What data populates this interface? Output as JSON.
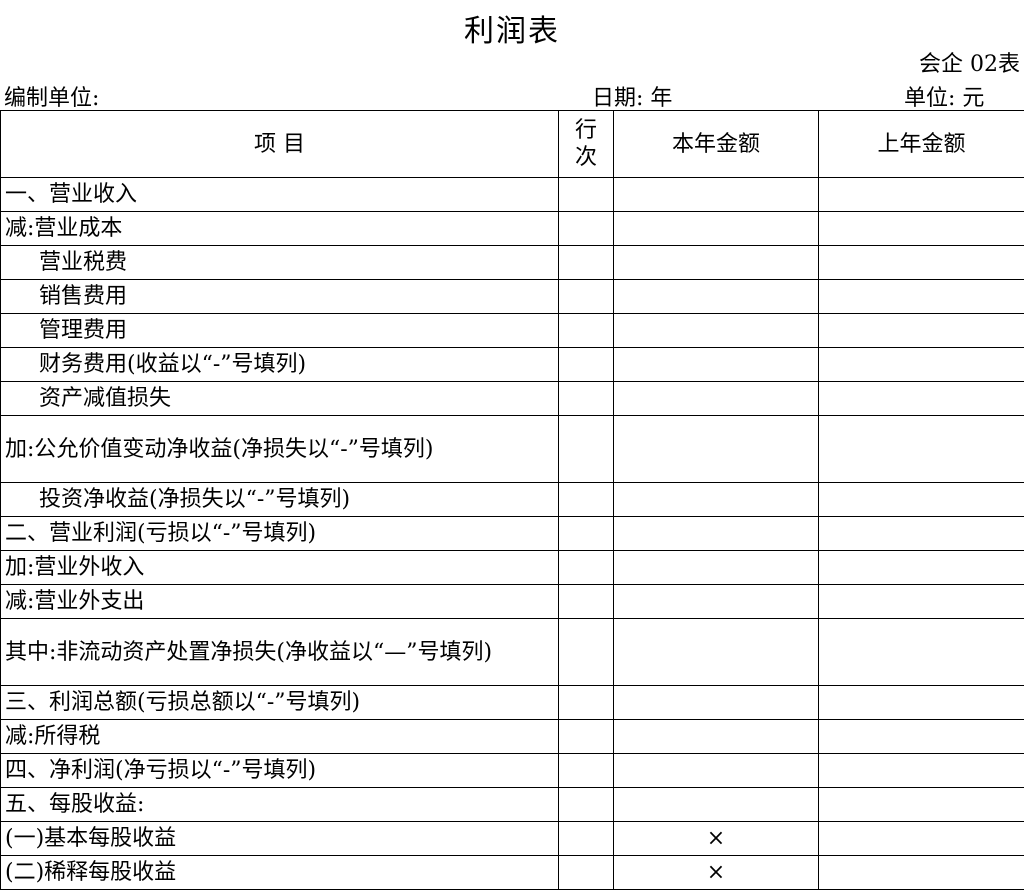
{
  "report": {
    "title": "利润表",
    "form_code": "会企 02表",
    "company_label": "编制单位:",
    "date_label": "日期:  年",
    "unit_label": "单位:  元"
  },
  "table": {
    "headers": [
      "项  目",
      "行次",
      "本年金额",
      "上年金额"
    ],
    "rows": [
      {
        "item": "一、营业收入",
        "indent": false,
        "current": "",
        "prior": ""
      },
      {
        "item": "减:营业成本",
        "indent": false,
        "current": "",
        "prior": ""
      },
      {
        "item": "营业税费",
        "indent": true,
        "current": "",
        "prior": ""
      },
      {
        "item": "销售费用",
        "indent": true,
        "current": "",
        "prior": ""
      },
      {
        "item": "管理费用",
        "indent": true,
        "current": "",
        "prior": ""
      },
      {
        "item": "财务费用(收益以“-”号填列)",
        "indent": true,
        "current": "",
        "prior": ""
      },
      {
        "item": "资产减值损失",
        "indent": true,
        "current": "",
        "prior": ""
      },
      {
        "item": "加:公允价值变动净收益(净损失以“-”号填列)",
        "indent": false,
        "current": "",
        "prior": ""
      },
      {
        "item": "投资净收益(净损失以“-”号填列)",
        "indent": true,
        "current": "",
        "prior": ""
      },
      {
        "item": "二、营业利润(亏损以“-”号填列)",
        "indent": false,
        "current": "",
        "prior": ""
      },
      {
        "item": "加:营业外收入",
        "indent": false,
        "current": "",
        "prior": ""
      },
      {
        "item": "减:营业外支出",
        "indent": false,
        "current": "",
        "prior": ""
      },
      {
        "item": "其中:非流动资产处置净损失(净收益以“—”号填列)",
        "indent": false,
        "current": "",
        "prior": ""
      },
      {
        "item": "三、利润总额(亏损总额以“-”号填列)",
        "indent": false,
        "current": "",
        "prior": ""
      },
      {
        "item": "减:所得税",
        "indent": false,
        "current": "",
        "prior": ""
      },
      {
        "item": "四、净利润(净亏损以“-”号填列)",
        "indent": false,
        "current": "",
        "prior": ""
      },
      {
        "item": "五、每股收益:",
        "indent": false,
        "current": "",
        "prior": ""
      },
      {
        "item": "(一)基本每股收益",
        "indent": false,
        "current": "×",
        "prior": ""
      },
      {
        "item": "(二)稀释每股收益",
        "indent": false,
        "current": "×",
        "prior": ""
      }
    ]
  }
}
